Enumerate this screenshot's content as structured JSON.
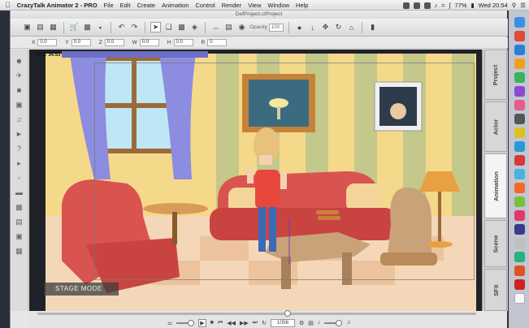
{
  "menubar": {
    "app_name": "CrazyTalk Animator 2 - PRO",
    "items": [
      "File",
      "Edit",
      "Create",
      "Animation",
      "Control",
      "Render",
      "View",
      "Window",
      "Help"
    ],
    "battery": "77%",
    "clock": "Wed 20:54"
  },
  "window": {
    "title": "DefProject.ctProject"
  },
  "toolbar": {
    "opacity_label": "Opacity",
    "opacity_value": "100"
  },
  "transform": {
    "fields": [
      {
        "label": "X",
        "value": "0.0"
      },
      {
        "label": "Y",
        "value": "0.0"
      },
      {
        "label": "Z",
        "value": "0.0"
      },
      {
        "label": "W",
        "value": "0.0"
      },
      {
        "label": "H",
        "value": "0.0"
      },
      {
        "label": "R",
        "value": "0"
      }
    ]
  },
  "stage": {
    "fps": "FPS: 34.53",
    "mode": "STAGE MODE"
  },
  "dock_tabs": [
    {
      "label": "Project",
      "active": false
    },
    {
      "label": "Actor",
      "active": false
    },
    {
      "label": "Animation",
      "active": true
    },
    {
      "label": "Scene",
      "active": false
    },
    {
      "label": "SFX",
      "active": false
    }
  ],
  "timeline": {
    "frame": "1056",
    "progress": 0.57
  },
  "colors": {
    "wall": "#f5d98a",
    "sofa": "#d9534f",
    "curtain": "#8c8ce0",
    "floor": "#f4d7b8"
  }
}
